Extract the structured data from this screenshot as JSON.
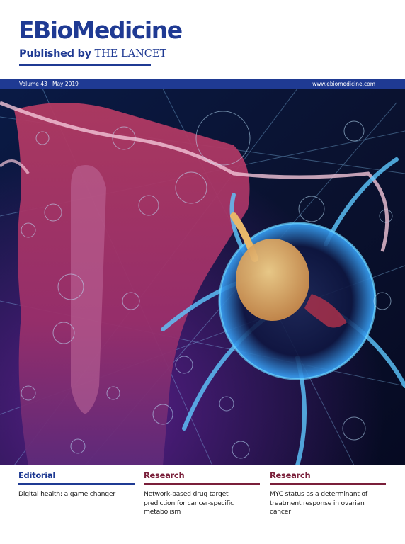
{
  "masthead": {
    "logo_e": "E",
    "logo_rest": "BioMedicine",
    "published_by": "Published by",
    "lancet": "THE LANCET"
  },
  "issue_bar": {
    "volume": "Volume 43 · May 2019",
    "url": "www.ebiomedicine.com"
  },
  "cover_sections": [
    {
      "heading": "Editorial",
      "title": "Digital health: a game changer"
    },
    {
      "heading": "Research",
      "title": "Network-based drug target prediction for cancer-specific metabolism"
    },
    {
      "heading": "Research",
      "title": "MYC status as a determinant of treatment response in ovarian cancer"
    }
  ],
  "colors": {
    "brand_blue": "#1f3a93",
    "research_maroon": "#7a1f3a"
  }
}
